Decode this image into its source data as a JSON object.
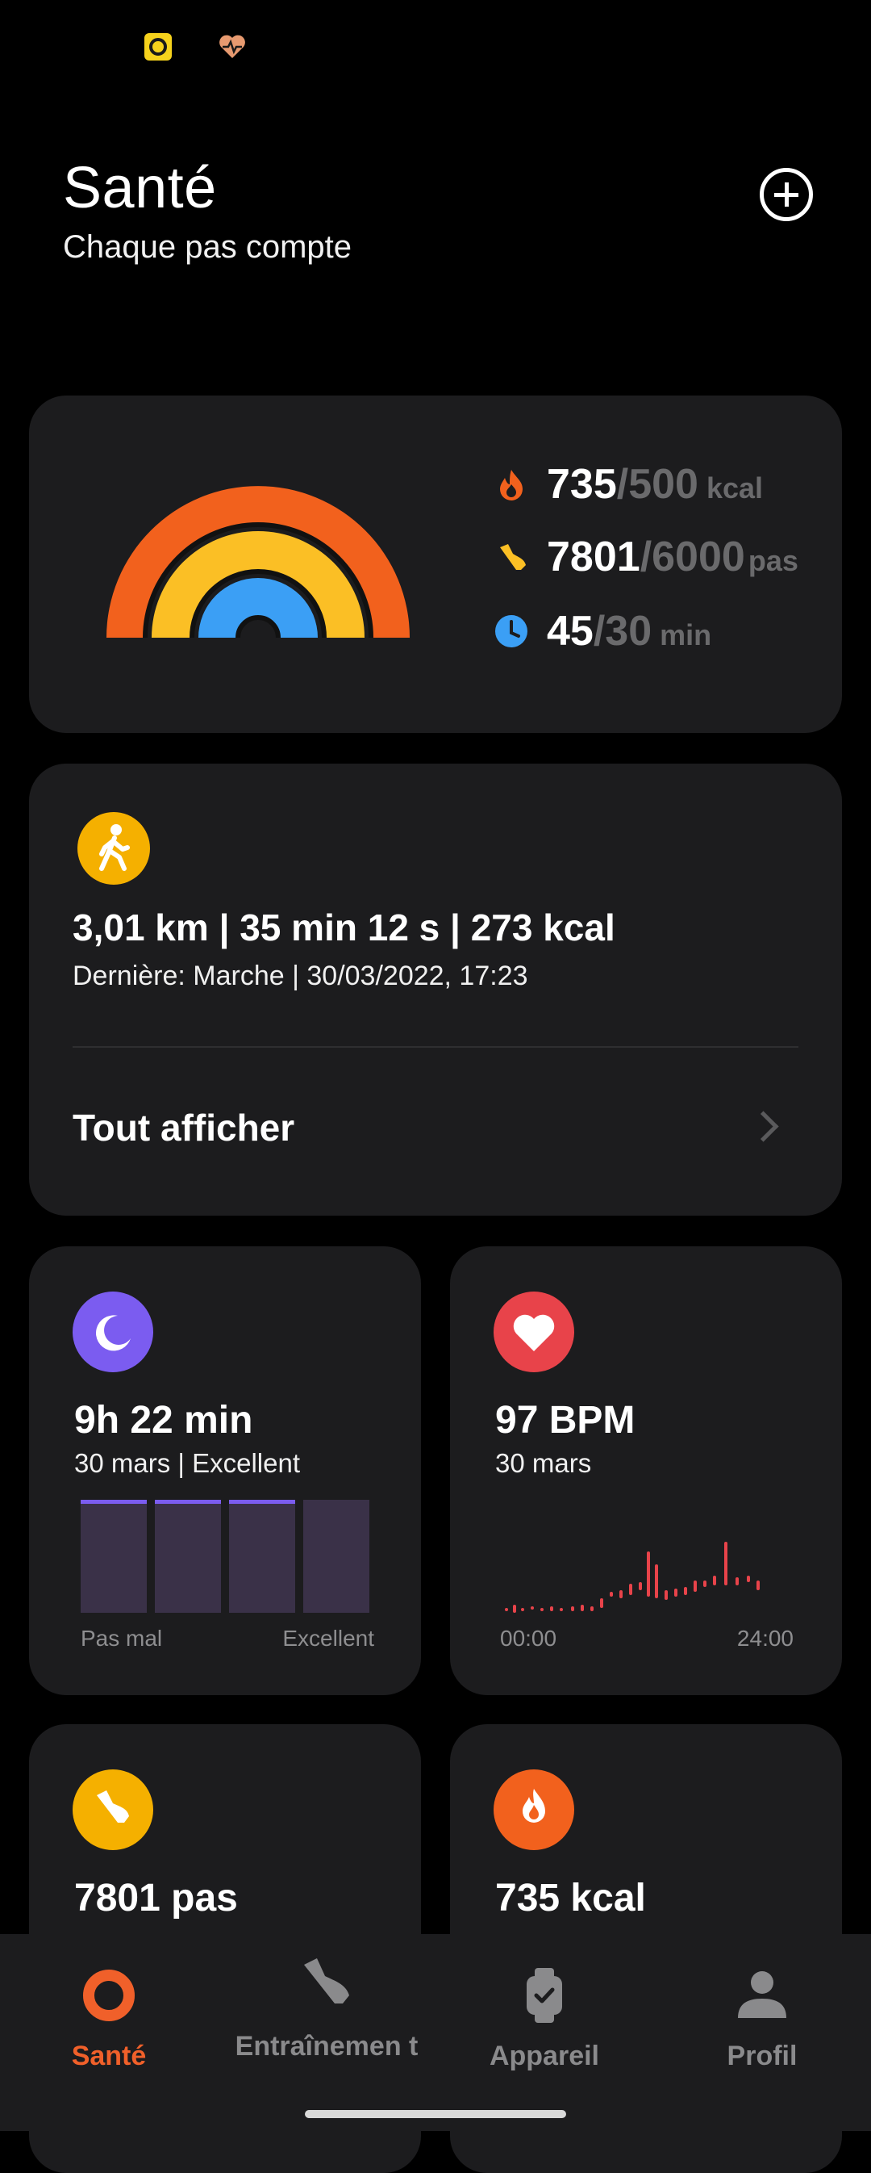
{
  "status_bar": {
    "icons": [
      "camera-notification-icon",
      "health-notification-icon"
    ]
  },
  "header": {
    "title": "Santé",
    "subtitle": "Chaque pas compte"
  },
  "activity": {
    "calories": {
      "value": "735",
      "target": "/500",
      "unit": "kcal",
      "progress": 1.47,
      "color": "#f2611d"
    },
    "steps": {
      "value": "7801",
      "target": "/6000",
      "unit": "pas",
      "progress": 1.3,
      "color": "#fbbf25"
    },
    "standing": {
      "value": "45",
      "target": "/30",
      "unit": "min",
      "progress": 1.5,
      "color": "#3b9ff5"
    }
  },
  "workout": {
    "summary": "3,01 km | 35 min 12 s | 273 kcal",
    "last": "Dernière: Marche | 30/03/2022, 17:23",
    "see_all": "Tout afficher"
  },
  "sleep": {
    "value": "9h 22 min",
    "sub": "30 mars | Excellent",
    "axis_left": "Pas mal",
    "axis_right": "Excellent",
    "bars_with_top": [
      true,
      true,
      true,
      false
    ]
  },
  "heart": {
    "value": "97 BPM",
    "sub": "30 mars",
    "axis_left": "00:00",
    "axis_right": "24:00",
    "color": "#e8434a"
  },
  "steps_card": {
    "value": "7801 pas"
  },
  "calories_card": {
    "value": "735 kcal"
  },
  "nav": {
    "items": [
      {
        "label": "Santé",
        "icon": "health-ring-icon",
        "active": true
      },
      {
        "label": "Entraînemen t",
        "icon": "shoe-icon",
        "active": false
      },
      {
        "label": "Appareil",
        "icon": "watch-icon",
        "active": false
      },
      {
        "label": "Profil",
        "icon": "person-icon",
        "active": false
      }
    ],
    "active_color": "#f0602a"
  }
}
